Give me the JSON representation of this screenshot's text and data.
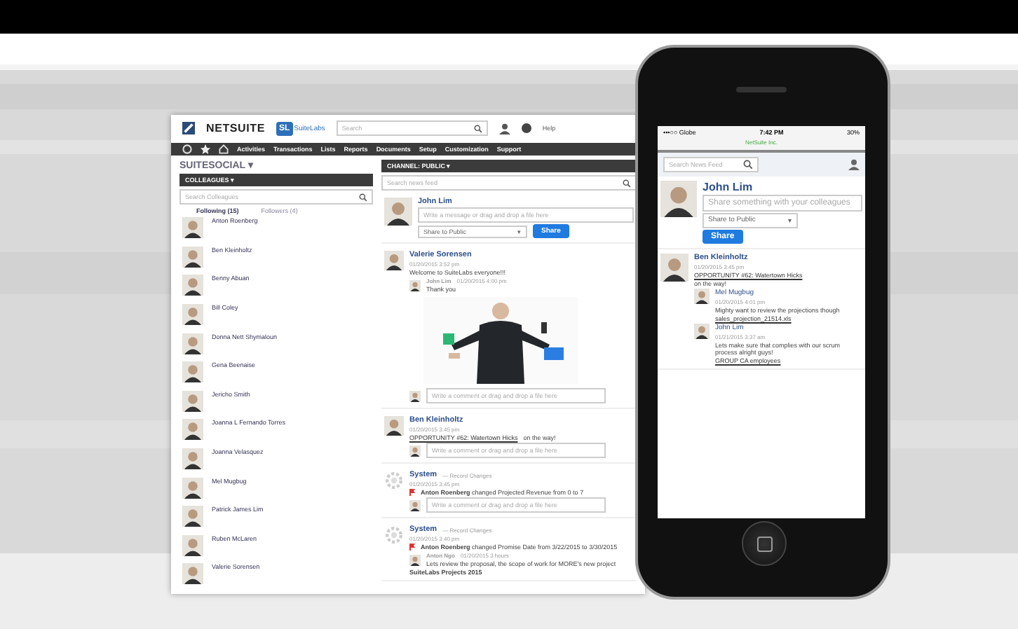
{
  "desktop": {
    "logo": "NETSUITE",
    "badge": "SL",
    "sub_logo": "SuiteLabs",
    "search": {
      "placeholder": "Search"
    },
    "help": "Help",
    "nav": [
      "Activities",
      "Transactions",
      "Lists",
      "Reports",
      "Documents",
      "Setup",
      "Customization",
      "Support"
    ],
    "sidebar": {
      "title": "SUITESOCIAL ▾",
      "section": "COLLEAGUES ▾",
      "search": {
        "placeholder": "Search Colleagues"
      },
      "tabs": [
        {
          "label": "Following (15)",
          "selected": true
        },
        {
          "label": "Followers (4)",
          "selected": false
        }
      ],
      "colleagues": [
        "Anton Roenberg",
        "Ben Kleinholtz",
        "Benny Abuan",
        "Bill Coley",
        "Donna Nett Shymaloun",
        "Gena Beenaise",
        "Jericho Smith",
        "Joanna L Fernando Torres",
        "Joanna Velasquez",
        "Mel Mugbug",
        "Patrick James Lim",
        "Ruben McLaren",
        "Valerie Sorensen"
      ]
    },
    "feed": {
      "channel": "CHANNEL: PUBLIC ▾",
      "search": {
        "placeholder": "Search news feed"
      },
      "composer": {
        "author": "John Lim",
        "placeholder": "Write a message or drag and drop a file here",
        "audience": "Share to Public",
        "caret": "▾",
        "button": "Share"
      },
      "posts": [
        {
          "kind": "person",
          "author": "Valerie Sorensen",
          "time": "01/20/2015 3:52 pm",
          "text": "Welcome to SuiteLabs everyone!!!",
          "media": {
            "kind": "picture"
          },
          "comments": [
            {
              "author": "John Lim",
              "time": "01/20/2015 4:00 pm",
              "text": "Thank you"
            }
          ],
          "comment_placeholder": "Write a comment or drag and drop a file here"
        },
        {
          "kind": "person",
          "author": "Ben Kleinholtz",
          "time": "01/20/2015 3:45 pm",
          "link": "OPPORTUNITY #62: Watertown Hicks",
          "text": "on the way!",
          "comment_placeholder": "Write a comment or drag and drop a file here"
        },
        {
          "kind": "system",
          "author": "System",
          "action": "— Record Changes",
          "time": "01/20/2015 3:45 pm",
          "actor": "Anton Roenberg",
          "text": "changed Projected Revenue from 0 to 7",
          "comment_placeholder": "Write a comment or drag and drop a file here"
        },
        {
          "kind": "system",
          "author": "System",
          "action": "— Record Changes",
          "time": "01/20/2015 3:40 pm",
          "actor": "Anton Roenberg",
          "text": "changed Promise Date from 3/22/2015 to 3/30/2015",
          "comments": [
            {
              "author": "Anton Ngo",
              "time": "01/20/2015 3 hours",
              "text": "Lets review the proposal, the scope of work for MORE's new project"
            }
          ],
          "attachment": "SuiteLabs Projects 2015"
        }
      ]
    }
  },
  "phone": {
    "carrier": "•••○○ Globe",
    "time": "7:42 PM",
    "battery": "30%",
    "site": "NetSuite Inc.",
    "search": {
      "placeholder": "Search News Feed"
    },
    "composer": {
      "author": "John Lim",
      "placeholder": "Share something with your colleagues",
      "audience": "Share to Public",
      "caret": "▾",
      "button": "Share"
    },
    "post": {
      "author": "Ben Kleinholtz",
      "time": "01/20/2015 3:45 pm",
      "link": "OPPORTUNITY #62: Watertown Hicks",
      "text": "on the way!",
      "comments": [
        {
          "author": "Mel Mugbug",
          "time": "01/20/2015 4:01 pm",
          "text": "Mighty want to review the projections though",
          "file": "sales_projection_21514.xls"
        },
        {
          "author": "John Lim",
          "time": "01/21/2015 3:37 am",
          "text": "Lets make sure that complies with our scrum process alright guys!",
          "file": "GROUP CA employees"
        }
      ]
    }
  }
}
